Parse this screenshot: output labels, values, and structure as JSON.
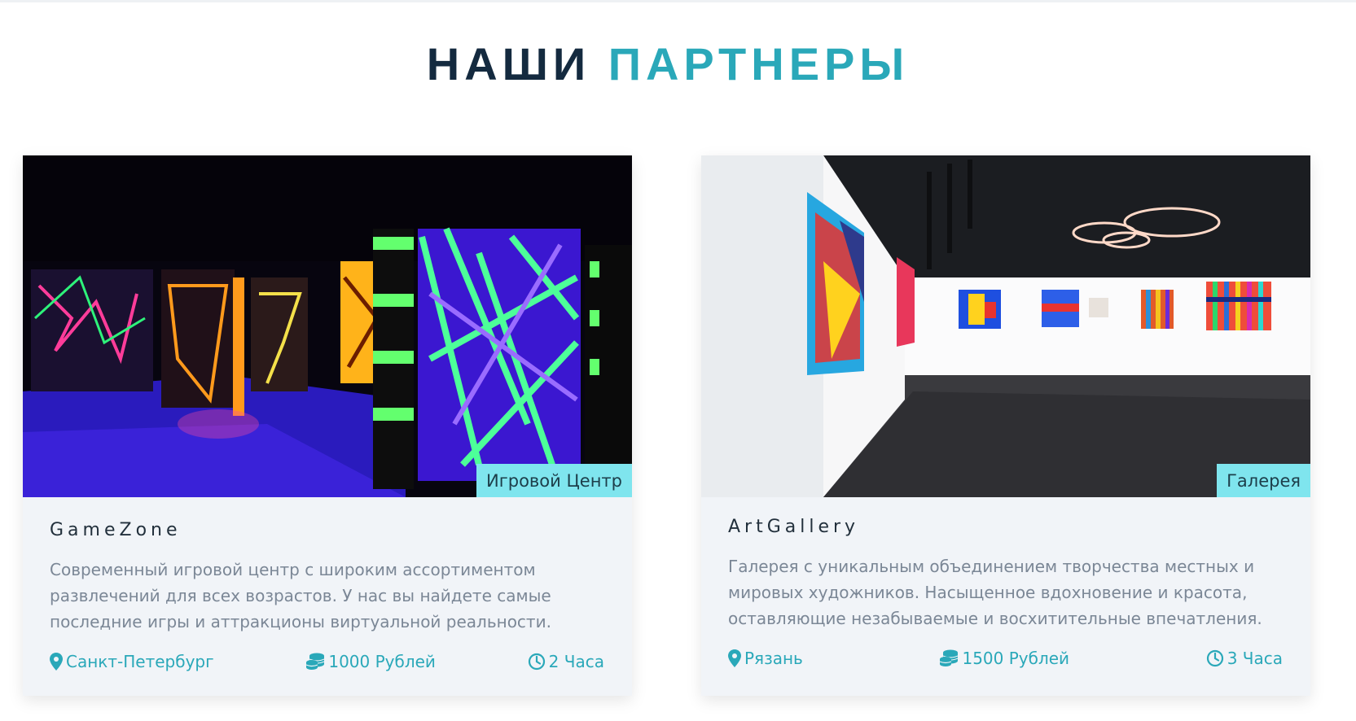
{
  "heading": {
    "part1": "НАШИ",
    "part2": "ПАРТНЕРЫ"
  },
  "colors": {
    "accent": "#2aa8b9",
    "dark": "#142a3f",
    "tag_bg": "#7fe5ee",
    "card_bg": "#f1f4f8"
  },
  "partners": [
    {
      "category": "Игровой Центр",
      "name": "GameZone",
      "description": "Современный игровой центр с широким ассортиментом развлечений для всех возрастов. У нас вы найдете самые последние игры и аттракционы виртуальной реальности.",
      "location": "Санкт-Петербург",
      "price": "1000 Рублей",
      "duration": "2 Часа",
      "image": "neon-laser-maze-photo"
    },
    {
      "category": "Галерея",
      "name": "ArtGallery",
      "description": "Галерея с уникальным объединением творчества местных и мировых художников. Насыщенное вдохновение и красота, оставляющие незабываемые и восхитительные впечатления.",
      "location": "Рязань",
      "price": "1500 Рублей",
      "duration": "3 Часа",
      "image": "art-gallery-hall-photo"
    }
  ],
  "icons": {
    "location": "map-pin-icon",
    "price": "coins-icon",
    "duration": "clock-icon"
  }
}
